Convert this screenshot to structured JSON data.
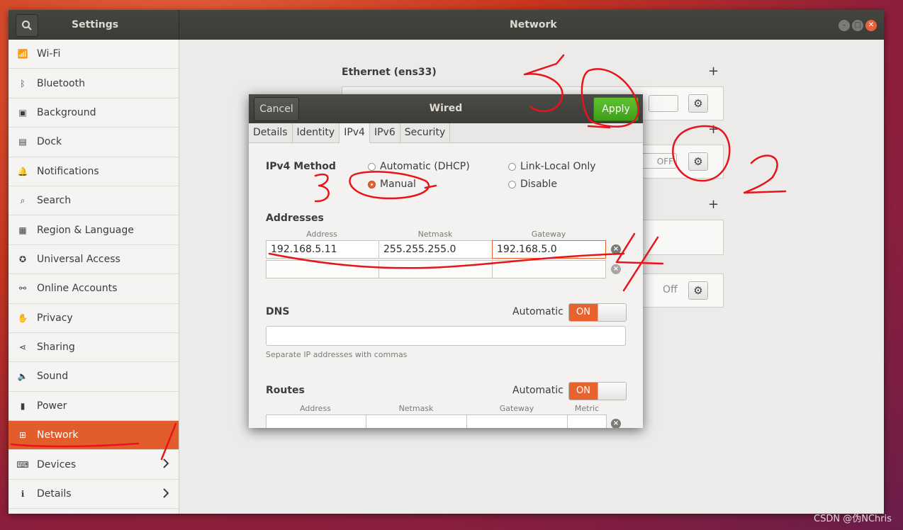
{
  "window": {
    "settings_title": "Settings",
    "panel_title": "Network"
  },
  "sidebar": {
    "items": [
      {
        "label": "Wi-Fi",
        "icon": "wifi-icon"
      },
      {
        "label": "Bluetooth",
        "icon": "bluetooth-icon"
      },
      {
        "label": "Background",
        "icon": "background-icon"
      },
      {
        "label": "Dock",
        "icon": "dock-icon"
      },
      {
        "label": "Notifications",
        "icon": "bell-icon"
      },
      {
        "label": "Search",
        "icon": "search-icon"
      },
      {
        "label": "Region & Language",
        "icon": "region-icon"
      },
      {
        "label": "Universal Access",
        "icon": "accessibility-icon"
      },
      {
        "label": "Online Accounts",
        "icon": "online-accounts-icon"
      },
      {
        "label": "Privacy",
        "icon": "hand-icon"
      },
      {
        "label": "Sharing",
        "icon": "share-icon"
      },
      {
        "label": "Sound",
        "icon": "speaker-icon"
      },
      {
        "label": "Power",
        "icon": "power-icon"
      },
      {
        "label": "Network",
        "icon": "network-icon",
        "active": true
      },
      {
        "label": "Devices",
        "icon": "devices-icon"
      },
      {
        "label": "Details",
        "icon": "info-icon"
      }
    ]
  },
  "network": {
    "ethernet_title": "Ethernet (ens33)",
    "off_label_1": "OFF",
    "off_label_2": "Off"
  },
  "dialog": {
    "title": "Wired",
    "cancel_label": "Cancel",
    "apply_label": "Apply",
    "tabs": [
      "Details",
      "Identity",
      "IPv4",
      "IPv6",
      "Security"
    ],
    "active_tab": "IPv4",
    "ipv4_method_label": "IPv4 Method",
    "methods": {
      "dhcp": "Automatic (DHCP)",
      "link_local": "Link-Local Only",
      "manual": "Manual",
      "disable": "Disable"
    },
    "selected_method": "Manual",
    "addresses_label": "Addresses",
    "address_headers": [
      "Address",
      "Netmask",
      "Gateway"
    ],
    "address_rows": [
      {
        "address": "192.168.5.11",
        "netmask": "255.255.255.0",
        "gateway": "192.168.5.0"
      },
      {
        "address": "",
        "netmask": "",
        "gateway": ""
      }
    ],
    "dns_label": "DNS",
    "dns_automatic_label": "Automatic",
    "dns_toggle": "ON",
    "dns_hint": "Separate IP addresses with commas",
    "routes_label": "Routes",
    "routes_automatic_label": "Automatic",
    "routes_toggle": "ON",
    "route_headers": [
      "Address",
      "Netmask",
      "Gateway",
      "Metric"
    ]
  },
  "annotations": {
    "labels": [
      "1",
      "2",
      "3",
      "4",
      "5"
    ],
    "color": "#e8141b"
  },
  "watermark": "CSDN @伪NChris",
  "colors": {
    "accent": "#e25d2b",
    "apply_green": "#4caf25",
    "titlebar": "#3c3c38"
  }
}
